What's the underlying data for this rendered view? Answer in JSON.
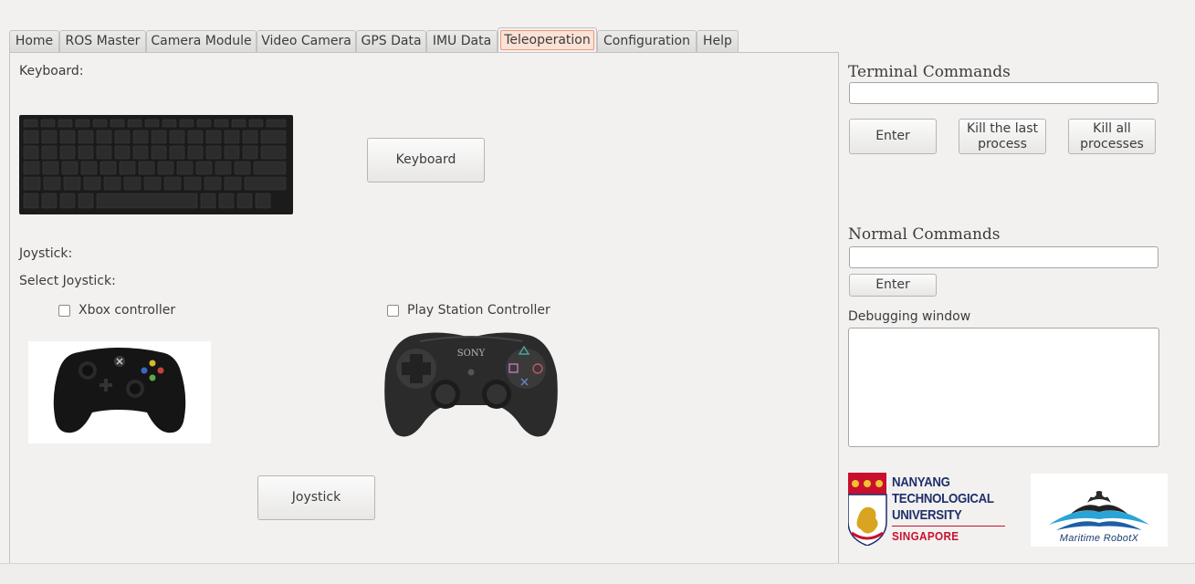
{
  "tabs": [
    "Home",
    "ROS Master",
    "Camera Module",
    "Video Camera",
    "GPS Data",
    "IMU Data",
    "Teleoperation",
    "Configuration",
    "Help"
  ],
  "active_tab": "Teleoperation",
  "teleop": {
    "keyboard_label": "Keyboard:",
    "keyboard_button": "Keyboard",
    "joystick_label": "Joystick:",
    "select_joystick_label": "Select Joystick:",
    "xbox_label": "Xbox controller",
    "ps_label": "Play Station Controller",
    "joystick_button": "Joystick"
  },
  "images": {
    "keyboard": "keyboard-image",
    "xbox": "xbox-controller-image",
    "ps": "playstation-controller-image",
    "ps_brand": "SONY"
  },
  "side": {
    "terminal_title": "Terminal Commands",
    "terminal_value": "",
    "enter_label": "Enter",
    "kill_last": "Kill the last process",
    "kill_all": "Kill all processes",
    "normal_title": "Normal Commands",
    "normal_value": "",
    "normal_enter": "Enter",
    "debug_title": "Debugging window",
    "debug_text": ""
  },
  "logos": {
    "ntu_line1": "NANYANG",
    "ntu_line2": "TECHNOLOGICAL",
    "ntu_line3": "UNIVERSITY",
    "ntu_line4": "SINGAPORE",
    "robotx": "Maritime RobotX"
  },
  "colors": {
    "active_tab_bg": "#fbe1d6",
    "active_tab_border": "#e99a7d",
    "ntu_blue": "#1f2f6b",
    "ntu_red": "#c8102e"
  }
}
